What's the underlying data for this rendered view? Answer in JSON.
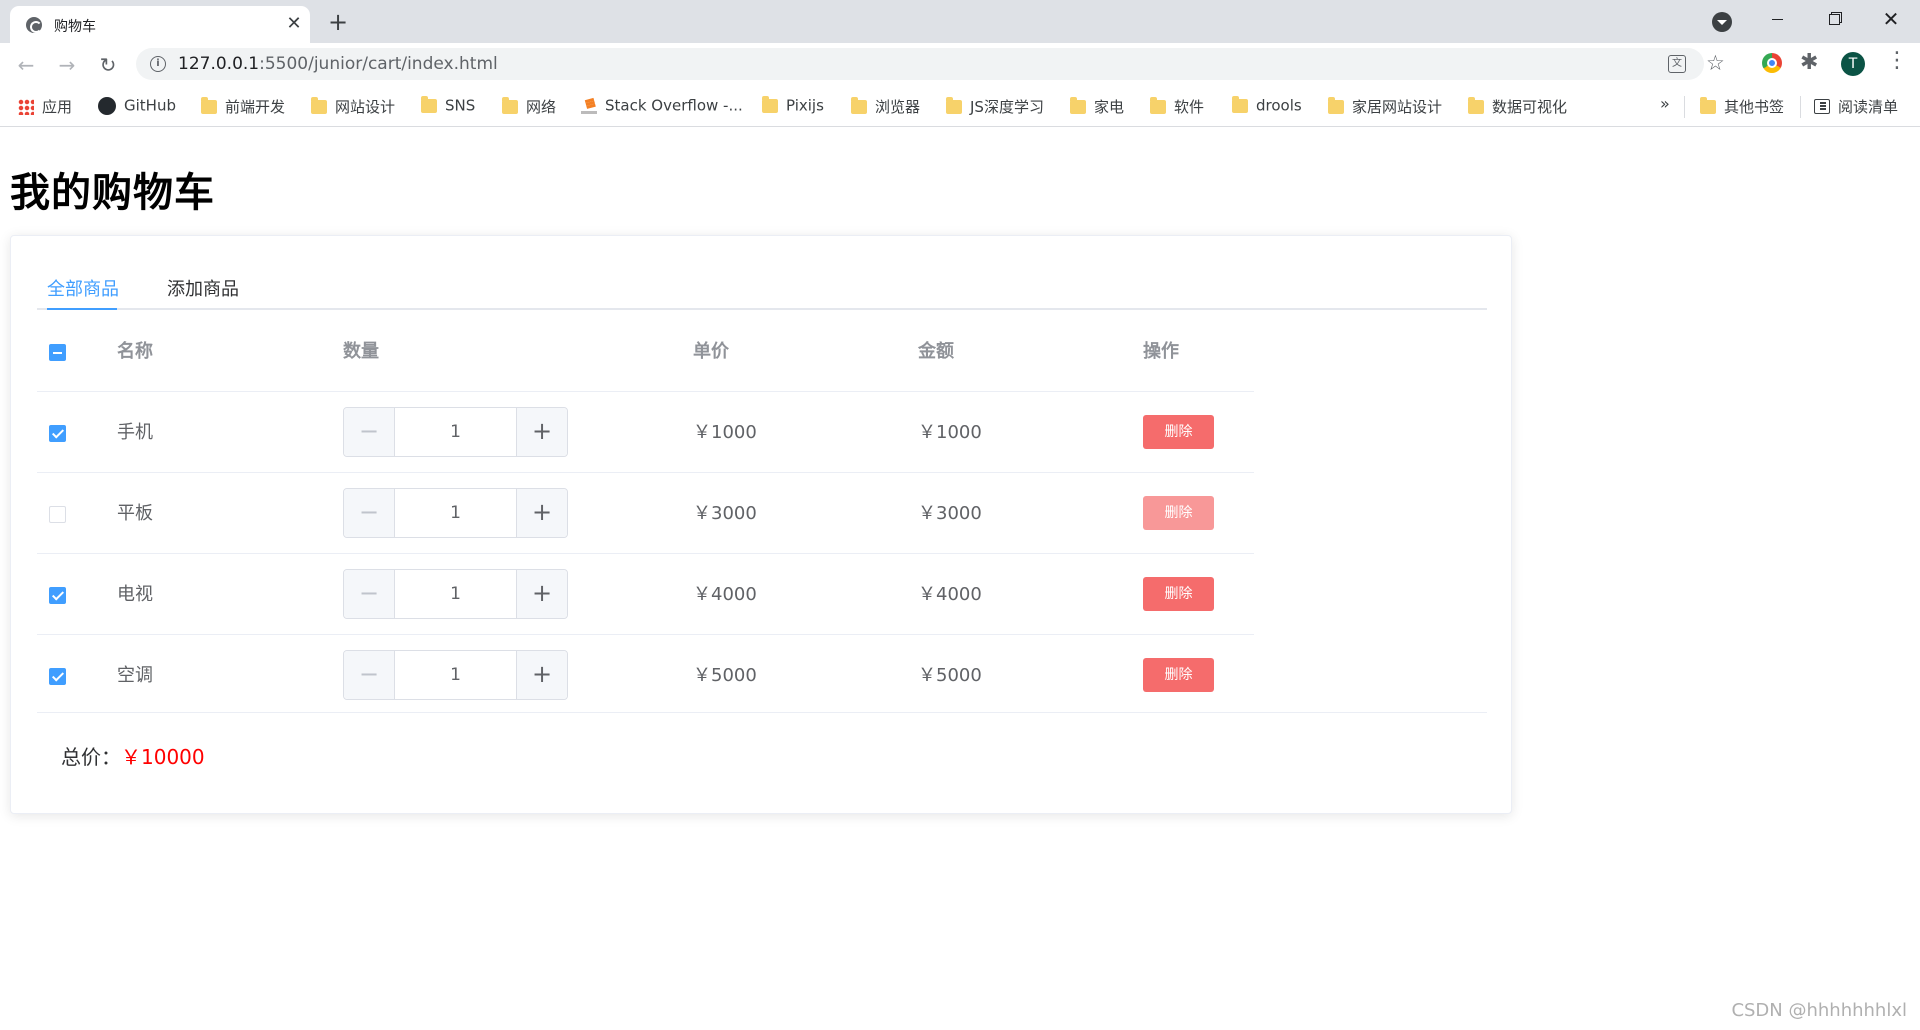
{
  "browser": {
    "tab_title": "购物车",
    "tab_close": "✕",
    "new_tab": "+",
    "url_host": "127.0.0.1",
    "url_rest": ":5500/junior/cart/index.html",
    "avatar_letter": "T",
    "bookmarks": [
      {
        "label": "应用",
        "icon": "apps-icon"
      },
      {
        "label": "GitHub",
        "icon": "github-icon"
      },
      {
        "label": "前端开发",
        "icon": "folder-icon"
      },
      {
        "label": "网站设计",
        "icon": "folder-icon"
      },
      {
        "label": "SNS",
        "icon": "folder-icon"
      },
      {
        "label": "网络",
        "icon": "folder-icon"
      },
      {
        "label": "Stack Overflow -...",
        "icon": "stackoverflow-icon"
      },
      {
        "label": "Pixijs",
        "icon": "folder-icon"
      },
      {
        "label": "浏览器",
        "icon": "folder-icon"
      },
      {
        "label": "JS深度学习",
        "icon": "folder-icon"
      },
      {
        "label": "家电",
        "icon": "folder-icon"
      },
      {
        "label": "软件",
        "icon": "folder-icon"
      },
      {
        "label": "drools",
        "icon": "folder-icon"
      },
      {
        "label": "家居网站设计",
        "icon": "folder-icon"
      },
      {
        "label": "数据可视化",
        "icon": "folder-icon"
      }
    ],
    "bookmarks_more": "»",
    "other_bookmarks": "其他书签",
    "reading_list": "阅读清单"
  },
  "page": {
    "title": "我的购物车",
    "tabs": [
      {
        "label": "全部商品",
        "active": true
      },
      {
        "label": "添加商品",
        "active": false
      }
    ],
    "columns": {
      "name": "名称",
      "qty": "数量",
      "price": "单价",
      "amount": "金额",
      "op": "操作"
    },
    "select_all_state": "indeterminate",
    "rows": [
      {
        "name": "手机",
        "qty": "1",
        "price": "￥1000",
        "amount": "￥1000",
        "checked": true,
        "delete_label": "删除"
      },
      {
        "name": "平板",
        "qty": "1",
        "price": "￥3000",
        "amount": "￥3000",
        "checked": false,
        "delete_label": "删除"
      },
      {
        "name": "电视",
        "qty": "1",
        "price": "￥4000",
        "amount": "￥4000",
        "checked": true,
        "delete_label": "删除"
      },
      {
        "name": "空调",
        "qty": "1",
        "price": "￥5000",
        "amount": "￥5000",
        "checked": true,
        "delete_label": "删除"
      }
    ],
    "stepper_dec": "−",
    "stepper_inc": "+",
    "total_label": "总价：",
    "total_value": "￥10000"
  },
  "watermark": "CSDN @hhhhhhhlxl",
  "colors": {
    "primary": "#409eff",
    "danger": "#f56c6c",
    "total": "#ff0000"
  }
}
